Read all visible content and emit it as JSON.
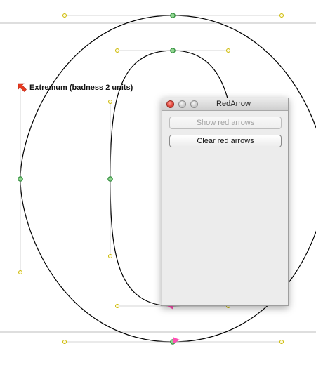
{
  "annotation": {
    "label": "Extremum (badness 2 units)",
    "icon": "red-arrow-icon",
    "color": "#e8391f"
  },
  "palette": {
    "title": "RedArrow",
    "show_button": "Show red arrows",
    "clear_button": "Clear red arrows"
  },
  "colors": {
    "oncurve_node": "#2e9b3b",
    "offcurve_handle": "#d4c400",
    "arrow_red": "#e8391f",
    "marker_pink": "#ff4fb3",
    "outline": "#000000",
    "metrics_line": "#b5b5b5"
  }
}
